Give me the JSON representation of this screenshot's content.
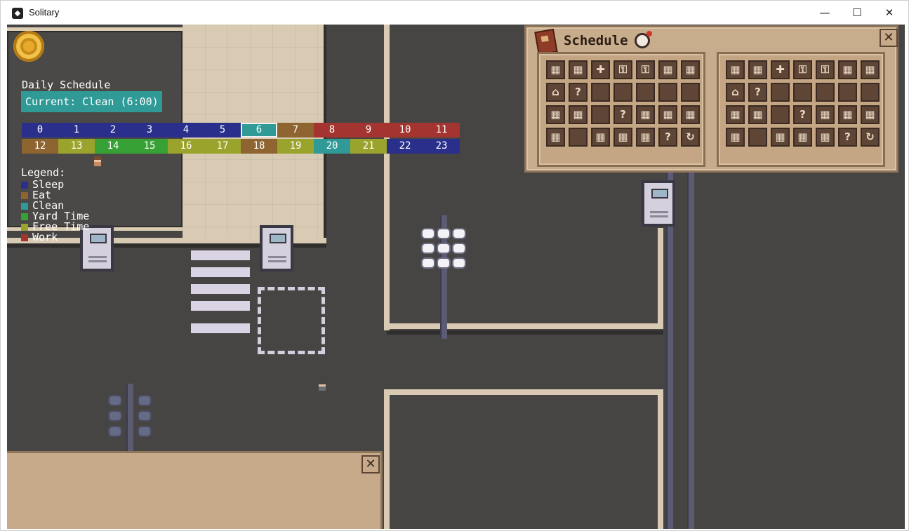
{
  "window": {
    "title": "Solitary",
    "app_icon": "app-logo-icon",
    "controls": {
      "minimize": "—",
      "maximize": "☐",
      "close": "✕"
    }
  },
  "hud": {
    "coin_icon": "coin-icon",
    "daily_schedule_title": "Daily Schedule",
    "current": "Current: Clean (6:00)",
    "current_hour": 6,
    "hours": [
      {
        "label": "0",
        "activity": "Sleep"
      },
      {
        "label": "1",
        "activity": "Sleep"
      },
      {
        "label": "2",
        "activity": "Sleep"
      },
      {
        "label": "3",
        "activity": "Sleep"
      },
      {
        "label": "4",
        "activity": "Sleep"
      },
      {
        "label": "5",
        "activity": "Sleep"
      },
      {
        "label": "6",
        "activity": "Clean"
      },
      {
        "label": "7",
        "activity": "Eat"
      },
      {
        "label": "8",
        "activity": "Work"
      },
      {
        "label": "9",
        "activity": "Work"
      },
      {
        "label": "10",
        "activity": "Work"
      },
      {
        "label": "11",
        "activity": "Work"
      },
      {
        "label": "12",
        "activity": "Eat"
      },
      {
        "label": "13",
        "activity": "Free Time"
      },
      {
        "label": "14",
        "activity": "Yard Time"
      },
      {
        "label": "15",
        "activity": "Yard Time"
      },
      {
        "label": "16",
        "activity": "Free Time"
      },
      {
        "label": "17",
        "activity": "Free Time"
      },
      {
        "label": "18",
        "activity": "Eat"
      },
      {
        "label": "19",
        "activity": "Free Time"
      },
      {
        "label": "20",
        "activity": "Clean"
      },
      {
        "label": "21",
        "activity": "Free Time"
      },
      {
        "label": "22",
        "activity": "Sleep"
      },
      {
        "label": "23",
        "activity": "Sleep"
      }
    ],
    "legend_title": "Legend:",
    "legend": [
      {
        "label": "Sleep",
        "color": "#2a2f8c"
      },
      {
        "label": "Eat",
        "color": "#8e6430"
      },
      {
        "label": "Clean",
        "color": "#2f9a96"
      },
      {
        "label": "Yard Time",
        "color": "#38a136"
      },
      {
        "label": "Free Time",
        "color": "#9aa32c"
      },
      {
        "label": "Work",
        "color": "#a33430"
      }
    ]
  },
  "schedule_window": {
    "title": "Schedule",
    "book_icon": "book-icon",
    "alarm_icon": "alarm-clock-icon",
    "close_label": "✕",
    "panels": [
      {
        "slots": [
          [
            "grid",
            "grid",
            "plus",
            "lock",
            "lock",
            "grid",
            "grid"
          ],
          [
            "home",
            "question",
            "empty",
            "empty",
            "empty",
            "empty",
            "empty"
          ],
          [
            "grid",
            "grid",
            "empty",
            "question",
            "grid",
            "grid",
            "grid"
          ],
          [
            "grid",
            "empty",
            "grid",
            "grid",
            "grid",
            "question",
            "refresh"
          ]
        ]
      },
      {
        "slots": [
          [
            "grid",
            "grid",
            "plus",
            "lock",
            "lock",
            "grid",
            "grid"
          ],
          [
            "home",
            "question",
            "empty",
            "empty",
            "empty",
            "empty",
            "empty"
          ],
          [
            "grid",
            "grid",
            "empty",
            "question",
            "grid",
            "grid",
            "grid"
          ],
          [
            "grid",
            "empty",
            "grid",
            "grid",
            "grid",
            "question",
            "refresh"
          ]
        ]
      }
    ]
  },
  "bottom_panel": {
    "close_label": "✕"
  },
  "colors": {
    "accent_teal": "#2f9a96",
    "panel_tan": "#c6aa8a"
  }
}
